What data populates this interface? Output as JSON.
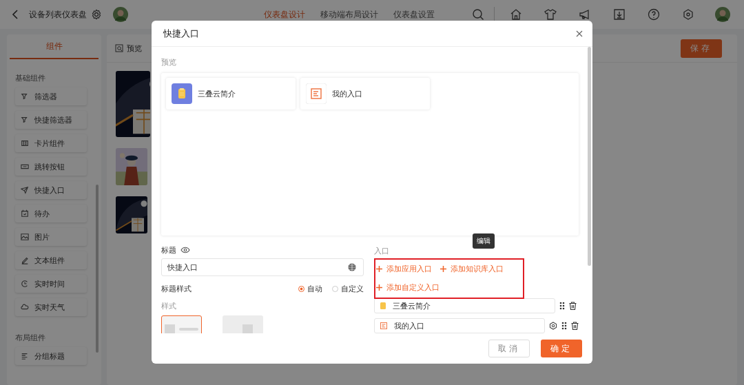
{
  "header": {
    "title": "设备列表仪表盘"
  },
  "nav_tabs": [
    {
      "label": "仪表盘设计",
      "selected": true
    },
    {
      "label": "移动端布局设计",
      "selected": false
    },
    {
      "label": "仪表盘设置",
      "selected": false
    }
  ],
  "sidebar": {
    "tabs": [
      {
        "label": "组件",
        "selected": true
      }
    ],
    "sections": [
      {
        "title": "基础组件",
        "items": [
          "筛选器",
          "快捷筛选器",
          "卡片组件",
          "跳转按钮",
          "快捷入口",
          "待办",
          "图片",
          "文本组件",
          "实时时间",
          "实时天气"
        ]
      },
      {
        "title": "布局组件",
        "items": [
          "分组标题"
        ]
      }
    ]
  },
  "canvas": {
    "tabs": [
      {
        "label": "预览"
      }
    ],
    "save_button": "保存",
    "cards": [
      {
        "kind": "dark"
      },
      {
        "kind": "pastel"
      },
      {
        "kind": "dark"
      }
    ]
  },
  "dialog": {
    "title": "快捷入口",
    "preview_label": "预览",
    "preview_items": [
      {
        "kind": "app",
        "label": "三叠云简介"
      },
      {
        "kind": "custom",
        "label": "我的入口"
      }
    ],
    "title_label": "标题",
    "title_value": "快捷入口",
    "title_style_label": "标题样式",
    "title_style_options": [
      {
        "label": "自动",
        "selected": true
      },
      {
        "label": "自定义",
        "selected": false
      }
    ],
    "style_label": "样式",
    "styles": [
      {
        "kind": "left",
        "selected": true
      },
      {
        "kind": "center",
        "selected": false
      }
    ],
    "entries_label": "入口",
    "add_actions": [
      "添加应用入口",
      "添加知识库入口",
      "添加自定义入口"
    ],
    "tooltip": "编辑",
    "entries": [
      {
        "kind": "app",
        "label": "三叠云简介",
        "settings": false
      },
      {
        "kind": "custom",
        "label": "我的入口",
        "settings": true
      }
    ],
    "cancel_button": "取消",
    "confirm_button": "确定"
  }
}
